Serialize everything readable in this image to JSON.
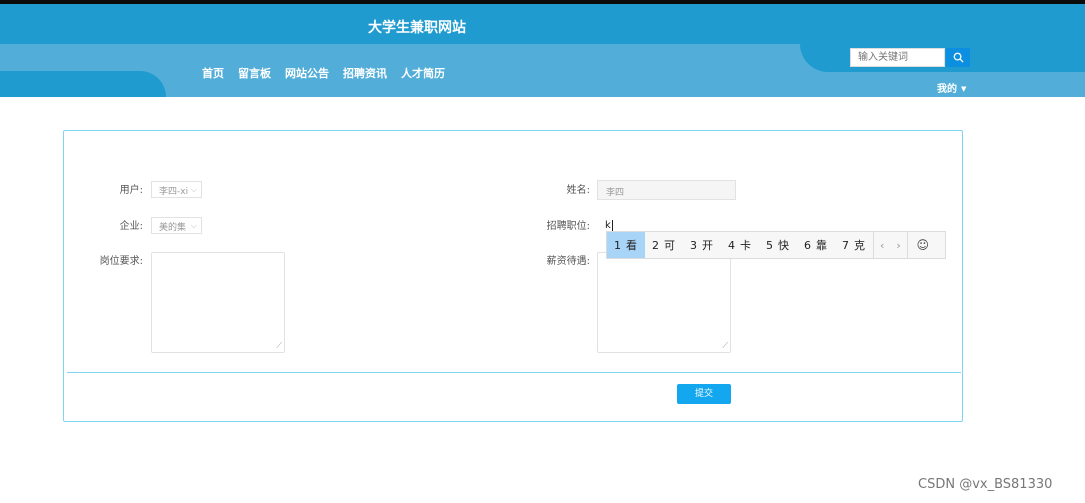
{
  "site": {
    "title": "大学生兼职网站"
  },
  "nav": {
    "items": [
      "首页",
      "留言板",
      "网站公告",
      "招聘资讯",
      "人才简历"
    ]
  },
  "search": {
    "placeholder": "输入关键词"
  },
  "user_menu": {
    "label": "我的"
  },
  "form": {
    "user_label": "用户:",
    "user_value": "李四-xi",
    "company_label": "企业:",
    "company_value": "美的集",
    "requirements_label": "岗位要求:",
    "name_label": "姓名:",
    "name_value": "李四",
    "position_label": "招聘职位:",
    "position_value": "k",
    "salary_label": "薪资待遇:",
    "submit_label": "提交"
  },
  "ime": {
    "candidates": [
      {
        "num": "1",
        "text": "看"
      },
      {
        "num": "2",
        "text": "可"
      },
      {
        "num": "3",
        "text": "开"
      },
      {
        "num": "4",
        "text": "卡"
      },
      {
        "num": "5",
        "text": "快"
      },
      {
        "num": "6",
        "text": "靠"
      },
      {
        "num": "7",
        "text": "克"
      }
    ],
    "prev": "‹",
    "next": "›",
    "emoji": "☺"
  },
  "colors": {
    "header_dark": "#1f9bd0",
    "header_light": "#52aed8",
    "accent": "#12a7ef",
    "border": "#7fd6ee"
  },
  "watermark": "CSDN @vx_BS81330"
}
